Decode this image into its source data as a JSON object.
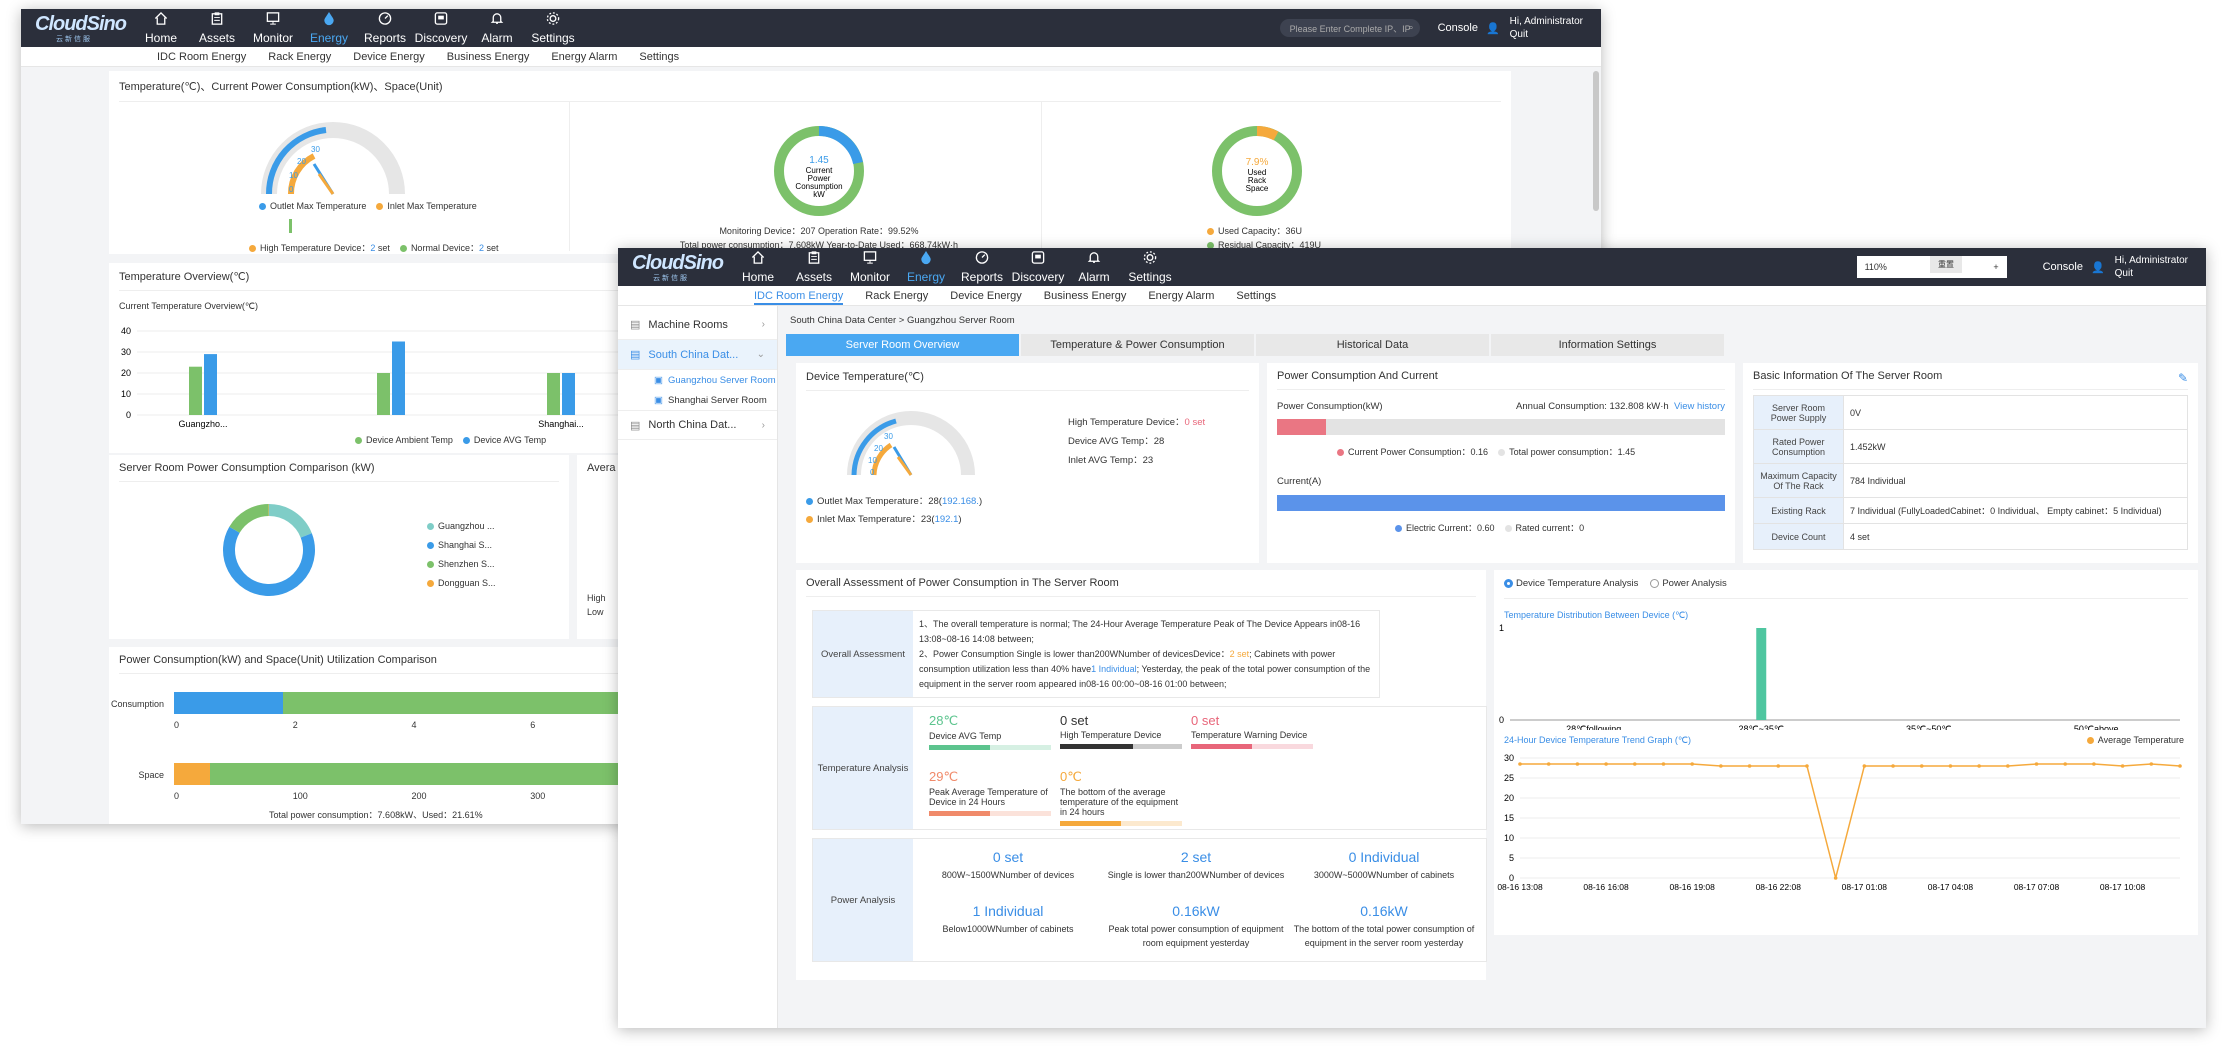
{
  "nav": {
    "logo": "CloudSino",
    "logo_sub": "云新信服",
    "items": [
      {
        "label": "Home",
        "icon": "home-icon"
      },
      {
        "label": "Assets",
        "icon": "clipboard-icon"
      },
      {
        "label": "Monitor",
        "icon": "monitor-icon"
      },
      {
        "label": "Energy",
        "icon": "drop-icon"
      },
      {
        "label": "Reports",
        "icon": "gauge-icon"
      },
      {
        "label": "Discovery",
        "icon": "camera-icon"
      },
      {
        "label": "Alarm",
        "icon": "bell-icon"
      },
      {
        "label": "Settings",
        "icon": "gear-icon"
      }
    ],
    "console": "Console",
    "greeting": "Hi,  Administrator",
    "quit": "Quit"
  },
  "w1": {
    "subnav": [
      "IDC Room Energy",
      "Rack Energy",
      "Device Energy",
      "Business Energy",
      "Energy Alarm",
      "Settings"
    ],
    "search_placeholder": "Please Enter Complete IP、IP",
    "top_title": "Temperature(℃)、Current Power Consumption(kW)、Space(Unit)",
    "gauge_legend": [
      "Outlet Max Temperature",
      "Inlet Max Temperature"
    ],
    "gauge_ticks": [
      "0",
      "10",
      "20",
      "30"
    ],
    "device_legend": {
      "high_label": "High Temperature Device：",
      "high_val": "2",
      "normal_label": "Normal Device：",
      "normal_val": "2",
      "unit": "set"
    },
    "power_donut": {
      "value": "1.45",
      "label1": "Current",
      "label2": "Power",
      "label3": "Consumption",
      "label4": "kW"
    },
    "power_info": {
      "line1": "Monitoring Device：207   Operation Rate：99.52%",
      "line2": "Total power consumption：7.608kW   Year-to-Date Used：668.74kW·h"
    },
    "space_donut": {
      "value": "7.9%",
      "label1": "Used",
      "label2": "Rack",
      "label3": "Space"
    },
    "space_legend": {
      "used": "Used Capacity：36U",
      "residual": "Residual Capacity：419U"
    },
    "temp_overview": {
      "title": "Temperature Overview(℃)",
      "subtitle": "Current Temperature Overview(℃)",
      "legend": [
        "Device Ambient Temp",
        "Device AVG Temp"
      ]
    },
    "comparison": {
      "title": "Server Room Power Consumption Comparison (kW)",
      "legend": [
        "Guangzhou ...",
        "Shanghai S...",
        "Shenzhen S...",
        "Dongguan S..."
      ],
      "side_title": "Avera",
      "side_lines": [
        "High",
        "Low"
      ]
    },
    "util": {
      "title": "Power Consumption(kW) and Space(Unit) Utilization Comparison",
      "row1": "Consumption",
      "row2": "Space",
      "axis1": [
        "0",
        "2",
        "4",
        "6"
      ],
      "axis2": [
        "0",
        "100",
        "200",
        "300",
        "400"
      ],
      "footer": "Total power consumption：7.608kW、Used：21.61%"
    },
    "colors": {
      "blue": "#3a9be8",
      "green": "#7cc16a",
      "orange": "#f5a93c",
      "teal": "#7fcdc7"
    }
  },
  "w2": {
    "subnav": [
      "IDC Room Energy",
      "Rack Energy",
      "Device Energy",
      "Business Energy",
      "Energy Alarm",
      "Settings"
    ],
    "zoom": {
      "value": "110%",
      "minus": "—",
      "plus": "+",
      "reset": "重置"
    },
    "sidebar": {
      "items": [
        {
          "label": "Machine Rooms"
        },
        {
          "label": "South China Dat...",
          "subs": [
            "Guangzhou Server Room",
            "Shanghai Server Room"
          ]
        },
        {
          "label": "North China Dat..."
        }
      ]
    },
    "breadcrumb": "South China Data Center >  Guangzhou Server Room",
    "tabs": [
      "Server Room Overview",
      "Temperature & Power Consumption",
      "Historical Data",
      "Information Settings"
    ],
    "device_temp": {
      "title": "Device Temperature(℃)",
      "high_label": "High Temperature Device：",
      "high_val": "0 set",
      "avg": "Device AVG Temp：28",
      "inlet": "Inlet AVG Temp：23",
      "outlet_label": "Outlet Max Temperature：28(",
      "outlet_ip": "192.168.",
      "outlet_end": ")",
      "inlet_label": "Inlet Max Temperature：23(",
      "inlet_ip": "192.1",
      "inlet_end": ")"
    },
    "power": {
      "title": "Power Consumption And Current",
      "pc_label": "Power Consumption(kW)",
      "annual": "Annual Consumption: 132.808 kW·h",
      "view": "View history",
      "legend1": "Current Power Consumption：0.16",
      "legend2": "Total power consumption：1.45",
      "cur_label": "Current(A)",
      "cur_legend1": "Electric Current：0.60",
      "cur_legend2": "Rated current：0",
      "pc_fraction": 0.11,
      "cur_fraction": 1.0
    },
    "basic": {
      "title": "Basic Information Of The Server Room",
      "rows": [
        {
          "k": "Server Room Power Supply",
          "v": "0V"
        },
        {
          "k": "Rated Power Consumption",
          "v": "1.452kW"
        },
        {
          "k": "Maximum Capacity Of The Rack",
          "v": "784 Individual"
        },
        {
          "k": "Existing Rack",
          "v": "7 Individual (FullyLoadedCabinet：0 Individual、 Empty cabinet：5 Individual)"
        },
        {
          "k": "Device Count",
          "v": "4 set"
        }
      ]
    },
    "assess": {
      "title": "Overall Assessment of Power Consumption in The Server Room",
      "label": "Overall Assessment",
      "line1": "1、The overall temperature is normal;  The 24-Hour Average Temperature Peak of The Device Appears in08-16 13:08~08-16 14:08 between;",
      "line2a": "2、Power Consumption Single is lower than200WNumber of devicesDevice：",
      "line2b": "2 set",
      "line2c": "; Cabinets with power consumption utilization less than 40% have",
      "line2d": "1 Individual",
      "line2e": "; Yesterday, the peak of the total power consumption of the equipment in the server room appeared in08-16 00:00~08-16 01:00 between;"
    },
    "tempan": {
      "label": "Temperature Analysis",
      "items": [
        {
          "v": "28℃",
          "d": "Device AVG Temp",
          "color": "#5cc48e"
        },
        {
          "v": "0 set",
          "d": "High Temperature Device",
          "color": "#333"
        },
        {
          "v": "0 set",
          "d": "Temperature Warning Device",
          "color": "#e8667a"
        },
        {
          "v": "29℃",
          "d": "Peak Average Temperature of Device in 24 Hours",
          "color": "#f08a6a"
        },
        {
          "v": "0℃",
          "d": "The bottom of the average temperature of the equipment in 24 hours",
          "color": "#f5a93c"
        }
      ],
      "fill": [
        0.5,
        0.6,
        0.5,
        0.5,
        0.5
      ]
    },
    "powan": {
      "label": "Power Analysis",
      "items": [
        {
          "v": "0 set",
          "d": "800W~1500WNumber of devices"
        },
        {
          "v": "2 set",
          "d": "Single is lower than200WNumber of devices"
        },
        {
          "v": "0 Individual",
          "d": "3000W~5000WNumber of cabinets"
        },
        {
          "v": "1 Individual",
          "d": "Below1000WNumber of cabinets"
        },
        {
          "v": "0.16kW",
          "d": "Peak total power consumption of equipment room equipment yesterday"
        },
        {
          "v": "0.16kW",
          "d": "The bottom of the total power consumption of equipment in the server room yesterday"
        }
      ]
    },
    "radio": [
      "Device Temperature Analysis",
      "Power Analysis"
    ],
    "dist": {
      "title": "Temperature Distribution Between Device (℃)"
    },
    "trend": {
      "title": "24-Hour Device Temperature Trend Graph (℃)",
      "legend": "Average Temperature"
    }
  },
  "chart_data": [
    {
      "type": "bar",
      "title": "Current Temperature Overview(℃)",
      "categories": [
        "Guangzho...",
        "Shanghai..."
      ],
      "series": [
        {
          "name": "Device Ambient Temp",
          "values": [
            23,
            20,
            20
          ]
        },
        {
          "name": "Device AVG Temp",
          "values": [
            29,
            35,
            20
          ]
        }
      ],
      "ylim": [
        0,
        40
      ],
      "yticks": [
        "0",
        "10",
        "20",
        "30",
        "40"
      ]
    },
    {
      "type": "pie",
      "title": "Server Room Power Consumption Comparison (kW)",
      "categories": [
        "Guangzhou ...",
        "Shanghai S...",
        "Shenzhen S...",
        "Dongguan S..."
      ],
      "values": [
        1.45,
        4.9,
        1.25,
        0.01
      ]
    },
    {
      "type": "bar",
      "title": "Temperature Distribution Between Device (℃)",
      "categories": [
        "28℃following",
        "28℃~35℃",
        "35℃~50℃",
        "50℃above"
      ],
      "values": [
        0,
        1,
        0,
        0
      ],
      "ylim": [
        0,
        1
      ],
      "yticks": [
        "0",
        "1"
      ]
    },
    {
      "type": "line",
      "title": "24-Hour Device Temperature Trend Graph (℃)",
      "x": [
        "08-16 13:08",
        "08-16 14:08",
        "08-16 15:08",
        "08-16 16:08",
        "08-16 17:08",
        "08-16 18:08",
        "08-16 19:08",
        "08-16 20:08",
        "08-16 21:08",
        "08-16 22:08",
        "08-16 23:08",
        "08-17 00:08",
        "08-17 01:08",
        "08-17 02:08",
        "08-17 03:08",
        "08-17 04:08",
        "08-17 05:08",
        "08-17 06:08",
        "08-17 07:08",
        "08-17 08:08",
        "08-17 09:08",
        "08-17 10:08",
        "08-17 11:08",
        "08-17 12:08"
      ],
      "xticks": [
        "08-16 13:08",
        "08-16 16:08",
        "08-16 19:08",
        "08-16 22:08",
        "08-17 01:08",
        "08-17 04:08",
        "08-17 07:08",
        "08-17 10:08"
      ],
      "series": [
        {
          "name": "Average Temperature",
          "values": [
            28.5,
            28.5,
            28.5,
            28.5,
            28.5,
            28.5,
            28.5,
            28,
            28,
            28,
            28,
            0,
            28,
            28,
            28,
            28,
            28,
            28,
            28.5,
            28.5,
            28.5,
            28,
            28.5,
            28
          ]
        }
      ],
      "ylim": [
        0,
        30
      ],
      "yticks": [
        "0",
        "5",
        "10",
        "15",
        "20",
        "25",
        "30"
      ]
    }
  ]
}
